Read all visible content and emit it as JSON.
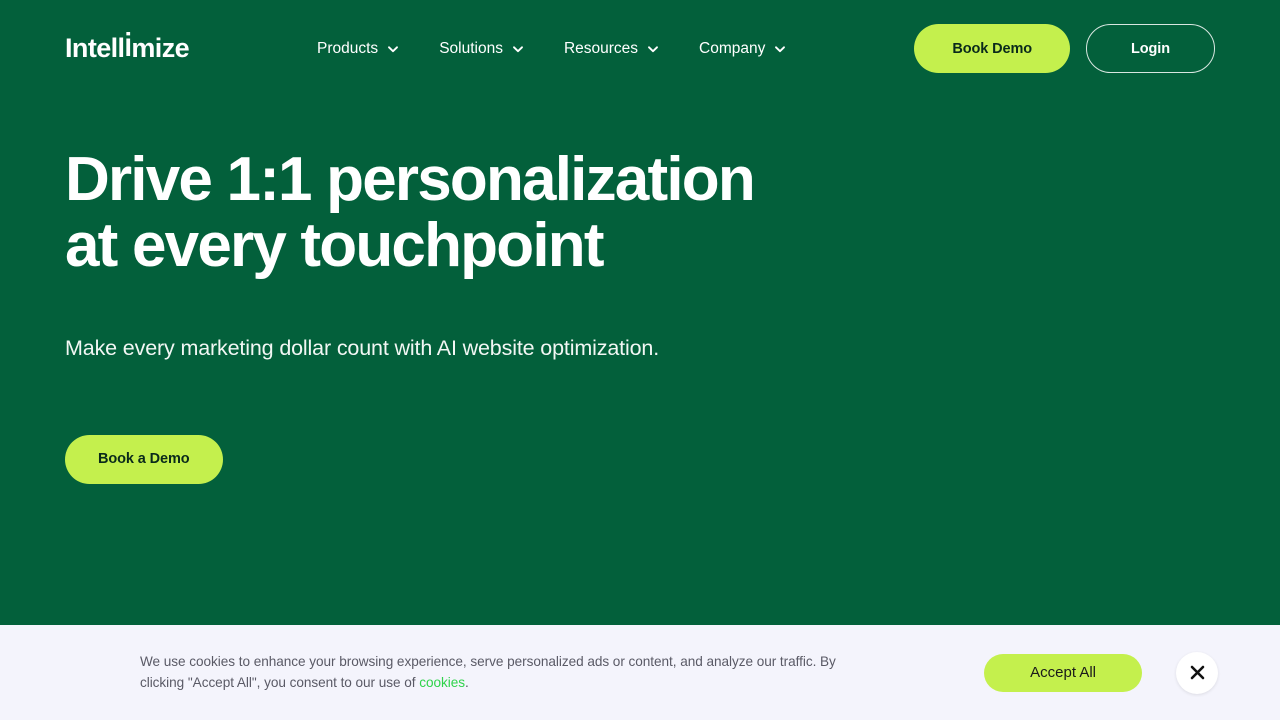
{
  "colors": {
    "hero_bg": "#03603B",
    "lime": "#C4F04D",
    "banner_bg": "#F4F4FC",
    "cookie_link": "#2FD34B",
    "text_white": "#FFFFFF",
    "dark_text": "#0A2A1B"
  },
  "header": {
    "logo": "Intellimize",
    "nav": [
      {
        "label": "Products",
        "icon": "chevron-down-icon"
      },
      {
        "label": "Solutions",
        "icon": "chevron-down-icon"
      },
      {
        "label": "Resources",
        "icon": "chevron-down-icon"
      },
      {
        "label": "Company",
        "icon": "chevron-down-icon"
      }
    ],
    "book_demo_label": "Book Demo",
    "login_label": "Login"
  },
  "hero": {
    "title_line1": "Drive 1:1 personalization",
    "title_line2": "at every touchpoint",
    "subtitle": "Make every marketing dollar count with AI website optimization.",
    "cta_label": "Book a Demo"
  },
  "cookie_banner": {
    "text_before": "We use cookies to enhance your browsing experience, serve personalized ads or content, and analyze our traffic. By clicking \"Accept All\", you consent to our use of ",
    "link_label": "cookies",
    "text_after": ".",
    "accept_label": "Accept All",
    "close_icon": "close-icon"
  }
}
